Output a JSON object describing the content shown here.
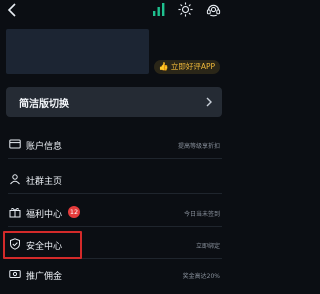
{
  "header": {
    "back_icon": "chevron-left-icon",
    "signal_icon": "signal-bars-icon",
    "theme_icon": "sun-icon",
    "support_icon": "customer-service-icon",
    "accent_color": "#1fc08f"
  },
  "rate_app": {
    "label": "立即好评APP",
    "icon": "thumb-up-icon",
    "color": "#f0b93a"
  },
  "switch_card": {
    "label": "简洁版切换"
  },
  "menu": {
    "items": [
      {
        "label": "账户信息",
        "subtitle": "提高等级享折扣",
        "icon": "card-icon"
      },
      {
        "label": "社群主页",
        "subtitle": "",
        "icon": "community-icon"
      },
      {
        "label": "福利中心",
        "subtitle": "今日当未签到",
        "icon": "gift-icon",
        "badge": "12"
      },
      {
        "label": "安全中心",
        "subtitle": "立即绑定",
        "icon": "shield-check-icon"
      },
      {
        "label": "推广佣金",
        "subtitle": "奖金高达20%",
        "icon": "money-icon"
      }
    ]
  },
  "highlight_color": "#d42a2a"
}
